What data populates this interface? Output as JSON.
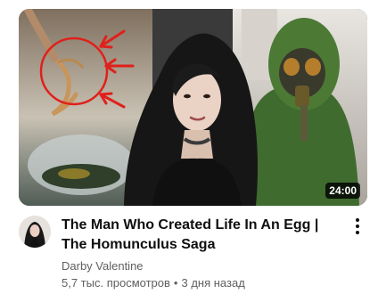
{
  "video": {
    "duration": "24:00",
    "title": "The Man Who Created Life In An Egg | The Homunculus Saga",
    "channel": "Darby Valentine",
    "views": "5,7 тыс. просмотров",
    "separator": "•",
    "age": "3 дня назад"
  },
  "icons": {
    "menu": "more-vert-icon",
    "avatar": "channel-avatar"
  },
  "colors": {
    "title": "#0f0f0f",
    "meta": "#606060",
    "annotation": "#e0201b"
  }
}
